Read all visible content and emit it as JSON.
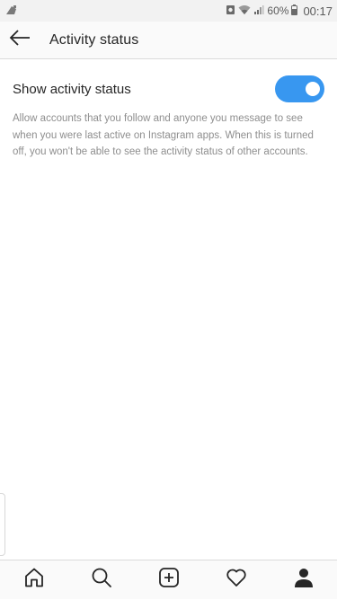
{
  "status_bar": {
    "battery_percent": "60%",
    "time": "00:17",
    "icons": [
      "notification-icon",
      "alarm-icon",
      "wifi-icon",
      "signal-icon",
      "battery-icon"
    ]
  },
  "header": {
    "title": "Activity status",
    "back_icon": "arrow-left-icon"
  },
  "setting": {
    "label": "Show activity status",
    "enabled": true,
    "description": "Allow accounts that you follow and anyone you message to see when you were last active on Instagram apps. When this is turned off, you won't be able to see the activity status of other accounts."
  },
  "colors": {
    "toggle_on": "#3897f0",
    "text_primary": "#262626",
    "text_secondary": "#8e8e8e",
    "divider": "#dbdbdb"
  },
  "bottom_nav": {
    "items": [
      "home-icon",
      "search-icon",
      "add-post-icon",
      "heart-icon",
      "profile-icon"
    ],
    "active": "profile-icon"
  }
}
